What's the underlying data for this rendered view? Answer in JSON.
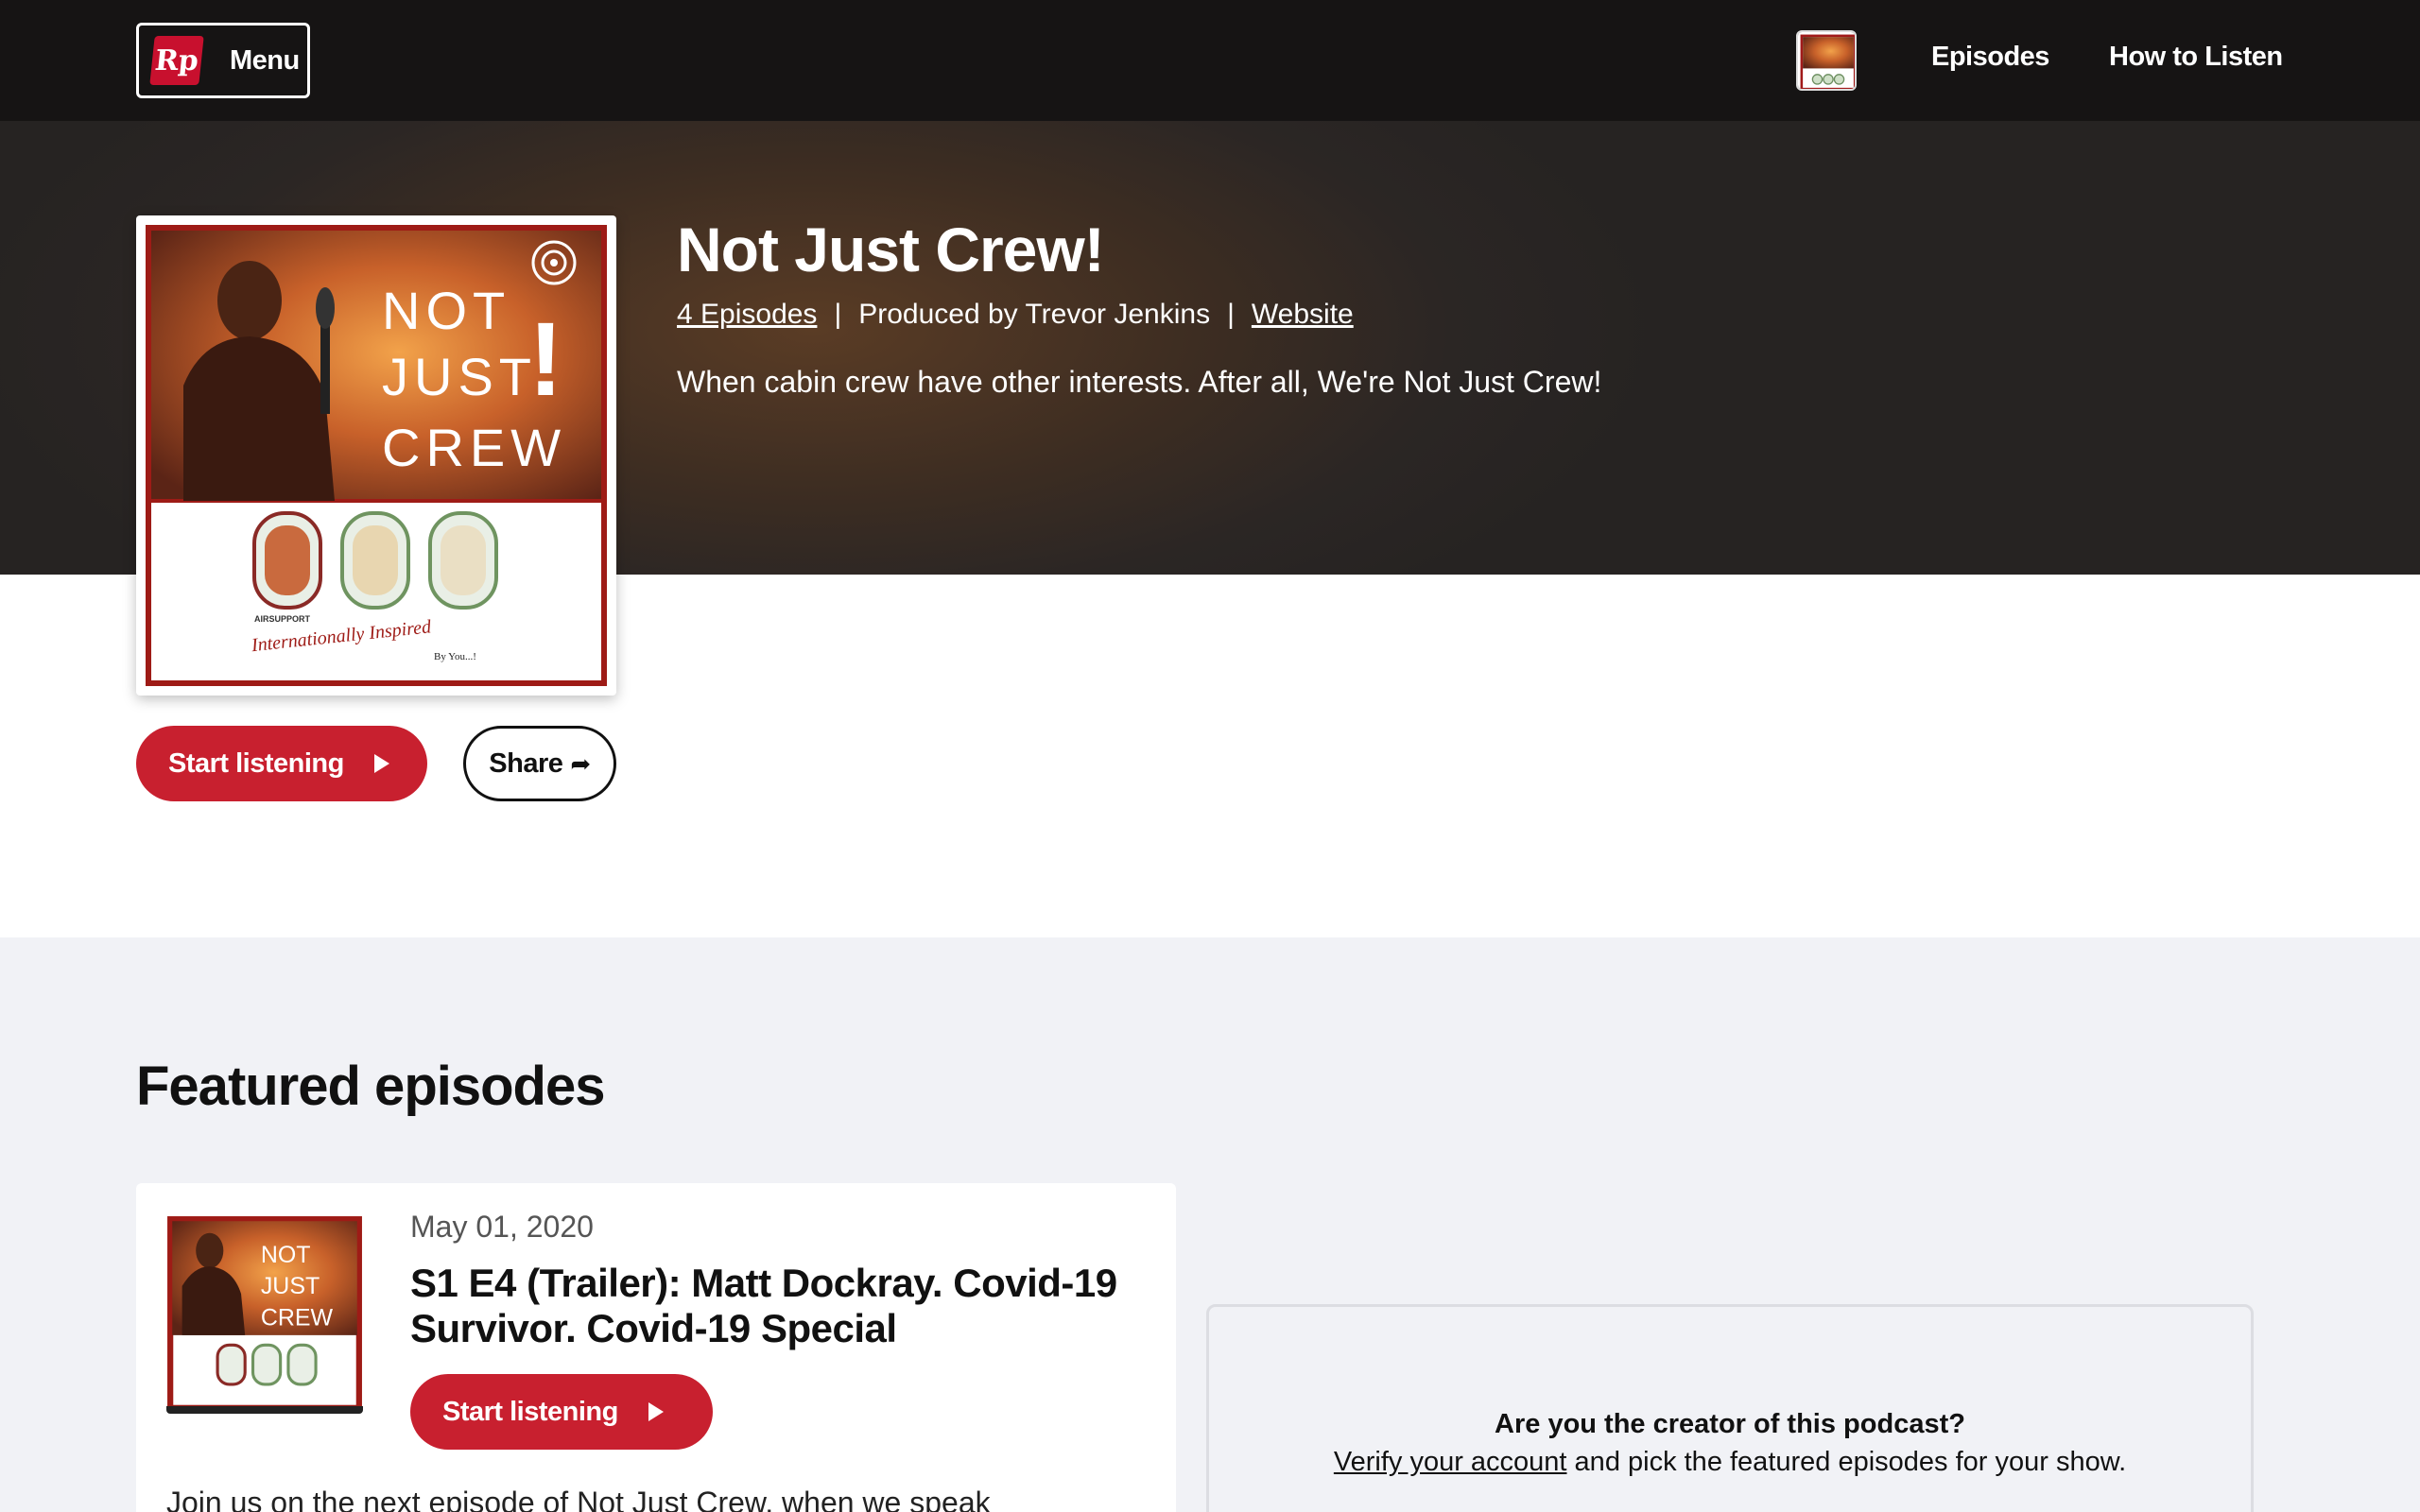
{
  "nav": {
    "logo_text": "Rp",
    "menu_label": "Menu",
    "links": [
      "Episodes",
      "How to Listen"
    ]
  },
  "podcast": {
    "title": "Not Just Crew!",
    "episodes_link": "4 Episodes",
    "separator": "|",
    "produced_by": "Produced by Trevor Jenkins",
    "website_link": "Website",
    "description": "When cabin crew have other interests. After all, We're Not Just Crew!",
    "cover_text": {
      "line1": "NOT",
      "line2": "JUST",
      "line3": "CREW",
      "bang": "!",
      "brand": "AIRSUPPORT",
      "tagline": "Internationally Inspired",
      "byline": "By You...!"
    }
  },
  "actions": {
    "start_listening": "Start listening",
    "share": "Share"
  },
  "featured": {
    "heading": "Featured episodes",
    "episode": {
      "date": "May 01, 2020",
      "title": "S1 E4 (Trailer): Matt Dockray. Covid-19 Survivor. Covid-19 Special",
      "button": "Start listening",
      "description": "Join us on the next episode of Not Just Crew, when we speak"
    }
  },
  "creator": {
    "question": "Are you the creator of this podcast?",
    "verify_link": "Verify your account",
    "rest": " and pick the featured episodes for your show."
  },
  "colors": {
    "accent_red": "#c8202f",
    "topbar": "#161414",
    "page_bg": "#f1f2f6"
  }
}
